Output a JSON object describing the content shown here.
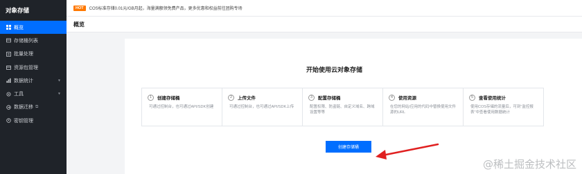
{
  "sidebar": {
    "title": "对象存储",
    "items": [
      {
        "label": "概览",
        "icon": "overview-icon",
        "active": true
      },
      {
        "label": "存储桶列表",
        "icon": "bucket-icon"
      },
      {
        "label": "批量处理",
        "icon": "batch-icon"
      },
      {
        "label": "资源包管理",
        "icon": "package-icon"
      },
      {
        "label": "数据统计",
        "icon": "chart-icon",
        "expandable": true
      },
      {
        "label": "工具",
        "icon": "tool-icon",
        "expandable": true
      },
      {
        "label": "数据迁移",
        "icon": "migrate-icon",
        "external": true
      },
      {
        "label": "密钥管理",
        "icon": "key-icon"
      }
    ]
  },
  "notice": {
    "badge": "HOT",
    "text": "COS标准存储0.01元/GB月起，海量满额领免费产品，更多优惠和权益前往团购专场"
  },
  "header": {
    "title": "概览"
  },
  "main": {
    "title": "开始使用云对象存储",
    "steps": [
      {
        "num": "1",
        "title": "创建存储桶",
        "desc": "可通过控制台，也可通过API/SDK创建"
      },
      {
        "num": "2",
        "title": "上传文件",
        "desc": "可通过控制台，也可通过API/SDK上传"
      },
      {
        "num": "3",
        "title": "配置存储桶",
        "desc": "配置权限、防盗链、自定义域名、跨域设置等等"
      },
      {
        "num": "4",
        "title": "使用资源",
        "desc": "在您的网站/应用的代码中替换使用文件源的URL"
      },
      {
        "num": "5",
        "title": "查看使用统计",
        "desc": "使用COS存储的流量后，可到\"监控报表\"中查看使用数据统计"
      }
    ],
    "create_button": "创建存储桶"
  },
  "watermark": "@稀土掘金技术社区",
  "colors": {
    "accent": "#006eff",
    "sidebar": "#1f2329",
    "hot": "#ff7800",
    "arrow": "#e02020"
  }
}
